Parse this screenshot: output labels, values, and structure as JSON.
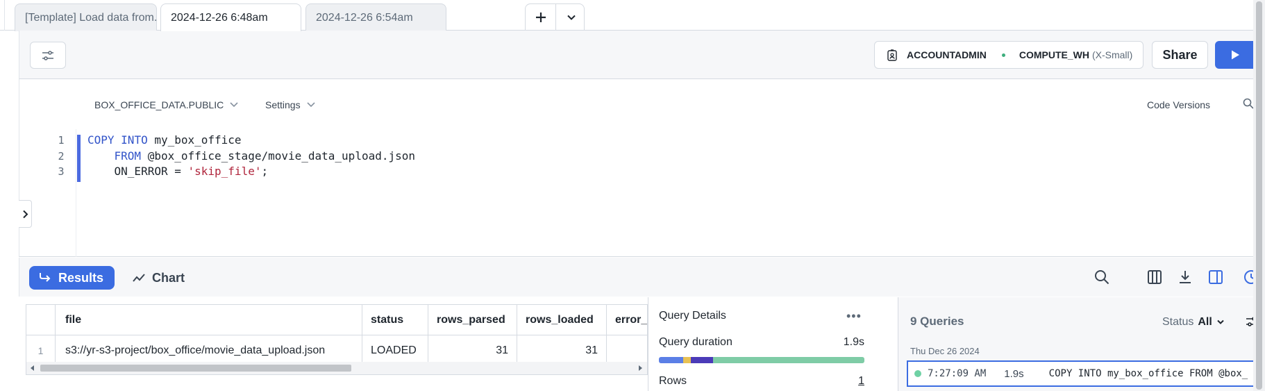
{
  "tabs": [
    {
      "label": "[Template] Load data from..."
    },
    {
      "label": "2024-12-26 6:48am"
    },
    {
      "label": "2024-12-26 6:54am"
    }
  ],
  "toolbar": {
    "role": "ACCOUNTADMIN",
    "warehouse": "COMPUTE_WH",
    "warehouse_size": "(X-Small)",
    "share_label": "Share"
  },
  "editor_header": {
    "database": "BOX_OFFICE_DATA.PUBLIC",
    "settings": "Settings",
    "code_versions": "Code Versions"
  },
  "editor": {
    "line_numbers": [
      "1",
      "2",
      "3"
    ],
    "line1": {
      "kw1": "COPY",
      "kw2": "INTO",
      "rest": " my_box_office"
    },
    "line2": {
      "indent": "    ",
      "kw": "FROM",
      "rest": " @box_office_stage/movie_data_upload.json"
    },
    "line3": {
      "indent": "    ",
      "pre": "ON_ERROR = ",
      "str": "'skip_file'",
      "post": ";"
    }
  },
  "results_bar": {
    "results_label": "Results",
    "chart_label": "Chart"
  },
  "grid": {
    "columns": [
      "file",
      "status",
      "rows_parsed",
      "rows_loaded",
      "error_l"
    ],
    "rows": [
      {
        "index": "1",
        "file": "s3://yr-s3-project/box_office/movie_data_upload.json",
        "status": "LOADED",
        "rows_parsed": "31",
        "rows_loaded": "31",
        "error_l": ""
      }
    ]
  },
  "query_details": {
    "title": "Query Details",
    "duration_label": "Query duration",
    "duration_value": "1.9s",
    "rows_label": "Rows",
    "rows_value": "1",
    "duration_segments": [
      {
        "color": "#5b7fe6"
      },
      {
        "color": "#e8c154"
      },
      {
        "color": "#4b3bb8"
      },
      {
        "color": "#7fcca6"
      }
    ]
  },
  "queries_panel": {
    "title": "9 Queries",
    "status_label": "Status",
    "status_value": "All",
    "date": "Thu Dec 26 2024",
    "item": {
      "time": "7:27:09 AM",
      "duration": "1.9s",
      "query": "COPY INTO my_box_office FROM @box_"
    }
  },
  "colors": {
    "accent": "#3b6ce1",
    "success": "#6fd1a4"
  }
}
